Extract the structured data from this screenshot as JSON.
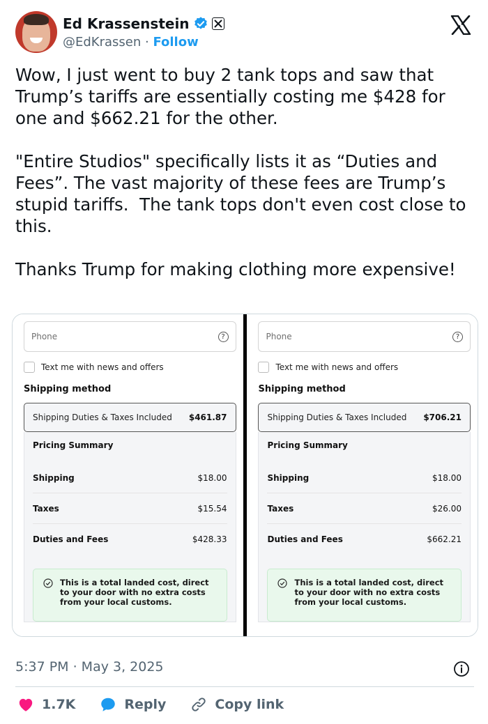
{
  "author": {
    "name": "Ed Krassenstein",
    "handle": "@EdKrassen",
    "separator": " · ",
    "follow_label": "Follow",
    "avatar_icon": "profile-photo",
    "verified_icon": "verified-badge-icon",
    "affiliate_icon": "x-affiliate-badge-icon"
  },
  "brand": {
    "logo_icon": "x-logo-icon",
    "accent": "#1d9bf0",
    "like_color": "#f91880"
  },
  "tweet": {
    "paragraphs": [
      "Wow, I just went to buy 2 tank tops and saw that Trump’s tariffs are essentially costing me $428 for one and $662.21 for the other.",
      "\"Entire Studios\" specifically lists it as “Duties and Fees”. The vast majority of these fees are Trump’s stupid tariffs.  The tank tops don't even cost close to this.",
      "Thanks Trump for making clothing more expensive!"
    ]
  },
  "screenshots": [
    {
      "phone_placeholder": "Phone",
      "help_glyph": "?",
      "checkbox_label": "Text me with news and offers",
      "shipping_method_heading": "Shipping method",
      "shipping_option_label": "Shipping Duties & Taxes Included",
      "shipping_option_amount": "$461.87",
      "pricing_summary_heading": "Pricing Summary",
      "rows": [
        {
          "label": "Shipping",
          "amount": "$18.00"
        },
        {
          "label": "Taxes",
          "amount": "$15.54"
        },
        {
          "label": "Duties and Fees",
          "amount": "$428.33"
        }
      ],
      "landed_note": "This is a total landed cost, direct to your door with no extra costs from your local customs."
    },
    {
      "phone_placeholder": "Phone",
      "help_glyph": "?",
      "checkbox_label": "Text me with news and offers",
      "shipping_method_heading": "Shipping method",
      "shipping_option_label": "Shipping Duties & Taxes Included",
      "shipping_option_amount": "$706.21",
      "pricing_summary_heading": "Pricing Summary",
      "rows": [
        {
          "label": "Shipping",
          "amount": "$18.00"
        },
        {
          "label": "Taxes",
          "amount": "$26.00"
        },
        {
          "label": "Duties and Fees",
          "amount": "$662.21"
        }
      ],
      "landed_note": "This is a total landed cost, direct to your door with no extra costs from your local customs."
    }
  ],
  "footer": {
    "timestamp": "5:37 PM · May 3, 2025",
    "info_icon": "info-icon",
    "actions": {
      "likes": "1.7K",
      "reply_label": "Reply",
      "copy_link_label": "Copy link"
    }
  }
}
